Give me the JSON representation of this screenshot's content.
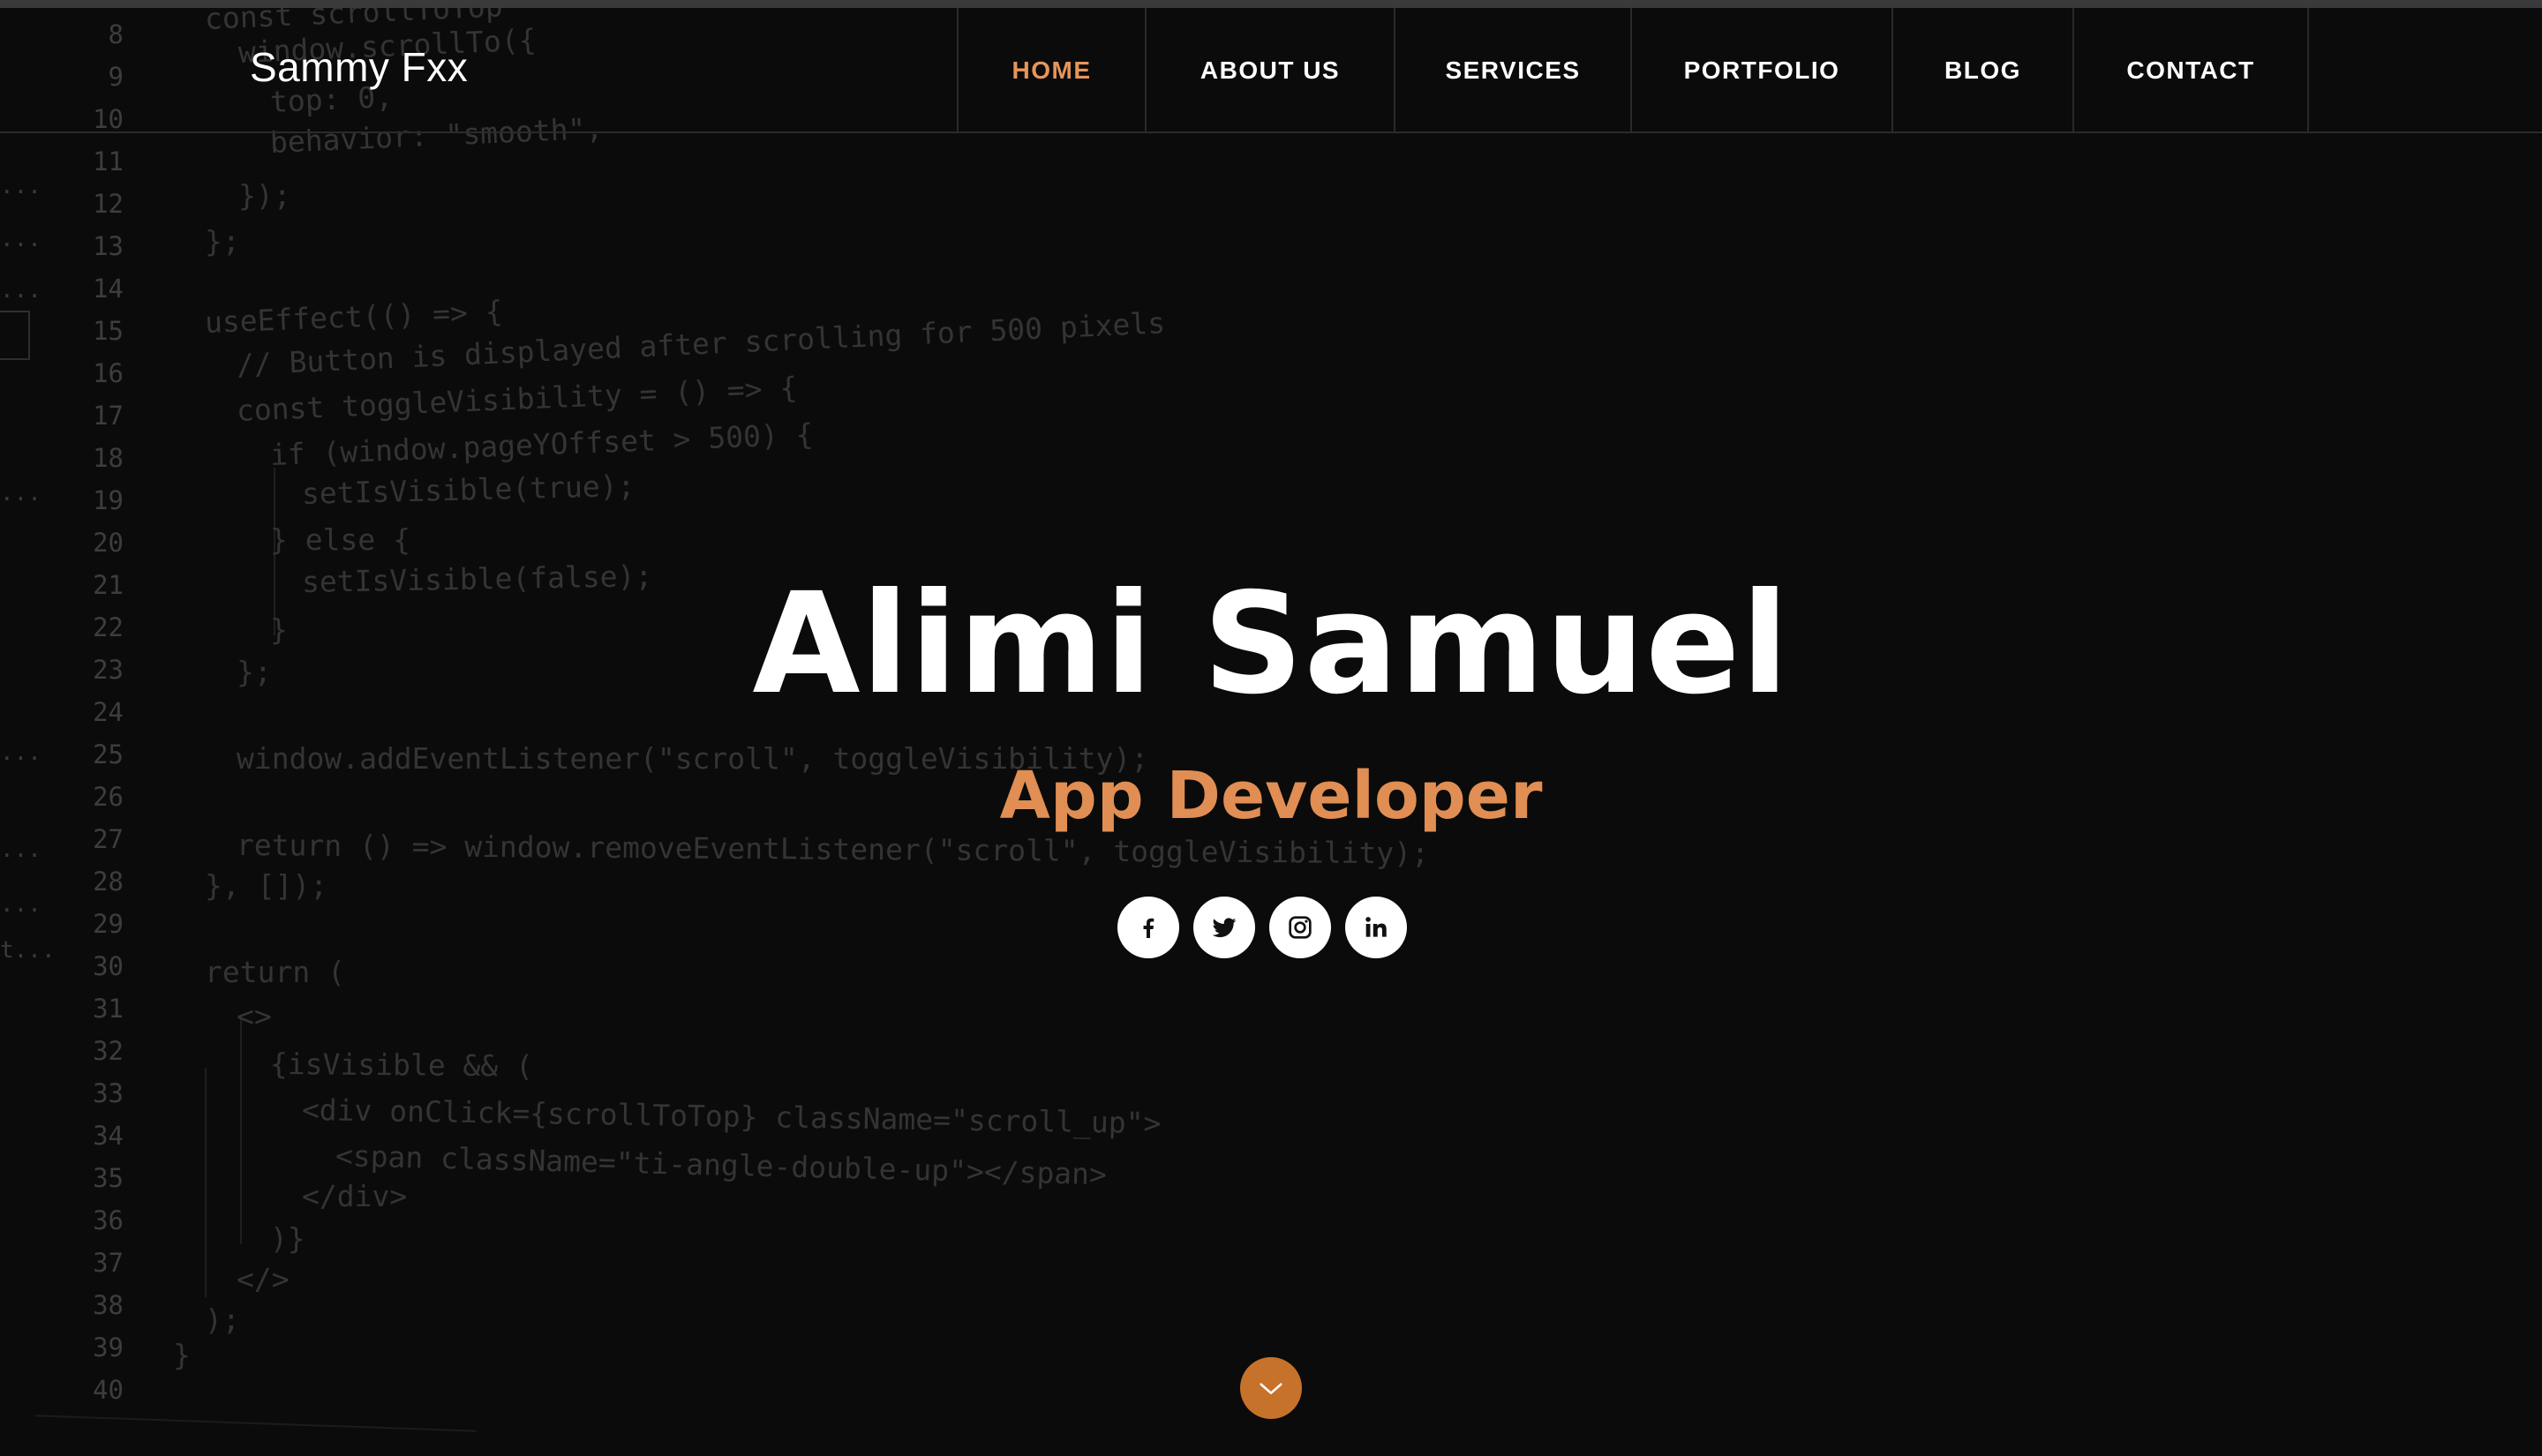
{
  "brand": "Sammy Fxx",
  "nav": {
    "items": [
      {
        "label": "HOME",
        "active": true
      },
      {
        "label": "ABOUT US",
        "active": false
      },
      {
        "label": "SERVICES",
        "active": false
      },
      {
        "label": "PORTFOLIO",
        "active": false
      },
      {
        "label": "BLOG",
        "active": false
      },
      {
        "label": "CONTACT",
        "active": false
      }
    ]
  },
  "hero": {
    "name": "Alimi Samuel",
    "role": "App Developer"
  },
  "socials": [
    {
      "network": "facebook",
      "icon": "facebook-icon"
    },
    {
      "network": "twitter",
      "icon": "twitter-icon"
    },
    {
      "network": "instagram",
      "icon": "instagram-icon"
    },
    {
      "network": "linkedin",
      "icon": "linkedin-icon"
    }
  ],
  "scroll_button": {
    "icon": "chevron-down-icon"
  },
  "colors": {
    "accent": "#e08e53",
    "scroll_button": "#c6722b",
    "background": "#0b0b0b",
    "text": "#ffffff"
  },
  "background_code": {
    "gutter_marks": [
      "...",
      "...",
      "...",
      "...",
      "...",
      "...",
      "...",
      "t..."
    ],
    "line_numbers": [
      "8",
      "9",
      "10",
      "11",
      "12",
      "13",
      "14",
      "15",
      "16",
      "17",
      "18",
      "19",
      "20",
      "21",
      "22",
      "23",
      "24",
      "25",
      "26",
      "27",
      "28",
      "29",
      "30",
      "31",
      "32",
      "33",
      "34",
      "35",
      "36",
      "37",
      "38",
      "39",
      "40"
    ],
    "lines": [
      "const scrollToTop",
      "window.scrollTo({",
      "top: 0,",
      "behavior: \"smooth\",",
      "});",
      "};",
      "useEffect(() => {",
      "// Button is displayed after scrolling for 500 pixels",
      "const toggleVisibility = () => {",
      "if (window.pageYOffset > 500) {",
      "setIsVisible(true);",
      "} else {",
      "setIsVisible(false);",
      "}",
      "};",
      "window.addEventListener(\"scroll\", toggleVisibility);",
      "return () => window.removeEventListener(\"scroll\", toggleVisibility);",
      "}, []);",
      "return (",
      "<>",
      "{isVisible && (",
      "<div onClick={scrollToTop} className=\"scroll_up\">",
      "<span className=\"ti-angle-double-up\"></span>",
      "</div>",
      ")}",
      "</>",
      ");",
      "}"
    ]
  }
}
